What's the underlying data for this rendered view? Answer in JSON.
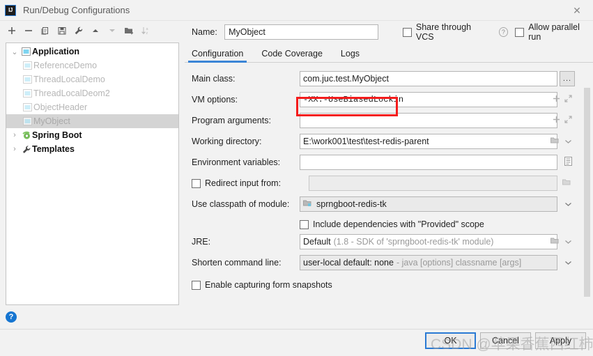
{
  "window": {
    "title": "Run/Debug Configurations",
    "app_icon": "intellij-idea-logo-icon",
    "close_icon": "✕"
  },
  "toolbar": {
    "buttons": [
      {
        "name": "add-configuration-button",
        "icon": "plus-icon"
      },
      {
        "name": "remove-configuration-button",
        "icon": "minus-icon"
      },
      {
        "name": "copy-configuration-button",
        "icon": "copy-icon"
      },
      {
        "name": "save-configuration-button",
        "icon": "save-icon"
      },
      {
        "name": "edit-templates-button",
        "icon": "wrench-icon"
      },
      {
        "name": "move-up-button",
        "icon": "arrow-up-icon"
      },
      {
        "name": "move-down-button",
        "icon": "arrow-down-icon"
      },
      {
        "name": "new-folder-button",
        "icon": "new-folder-icon"
      },
      {
        "name": "sort-configurations-button",
        "icon": "sort-az-icon"
      }
    ]
  },
  "tree": {
    "nodes": [
      {
        "label": "Application",
        "level": 0,
        "expanded": true,
        "twisty": "⌄",
        "icon": "application-icon",
        "selected": false
      },
      {
        "label": "ReferenceDemo",
        "level": 1,
        "twisty": "",
        "icon": "run-config-icon",
        "selected": false
      },
      {
        "label": "ThreadLocalDemo",
        "level": 1,
        "twisty": "",
        "icon": "run-config-icon",
        "selected": false
      },
      {
        "label": "ThreadLocalDeom2",
        "level": 1,
        "twisty": "",
        "icon": "run-config-icon",
        "selected": false
      },
      {
        "label": "ObjectHeader",
        "level": 1,
        "twisty": "",
        "icon": "run-config-icon",
        "selected": false
      },
      {
        "label": "MyObject",
        "level": 1,
        "twisty": "",
        "icon": "run-config-icon",
        "selected": true
      },
      {
        "label": "Spring Boot",
        "level": 0,
        "expanded": false,
        "twisty": "›",
        "icon": "spring-boot-icon",
        "selected": false
      },
      {
        "label": "Templates",
        "level": 0,
        "expanded": false,
        "twisty": "›",
        "icon": "wrench-icon",
        "selected": false
      }
    ]
  },
  "help": {
    "label": "?",
    "name": "help-button"
  },
  "header": {
    "name_label": "Name:",
    "name_value": "MyObject",
    "name_placeholder": "",
    "share_vcs_label": "Share through VCS",
    "share_vcs_checked": false,
    "share_help_icon": "question-mark-icon",
    "allow_parallel_label": "Allow parallel run",
    "allow_parallel_checked": false
  },
  "tabs": [
    {
      "label": "Configuration",
      "active": true
    },
    {
      "label": "Code Coverage",
      "active": false
    },
    {
      "label": "Logs",
      "active": false
    }
  ],
  "form": {
    "main_class": {
      "label": "Main class:",
      "value": "com.juc.test.MyObject",
      "browse_label": "..."
    },
    "vm_options": {
      "label": "VM options:",
      "value": "-XX:-UseBiasedLockin",
      "add_icon": "plus-icon",
      "expand_icon": "expand-icon",
      "highlighted": true,
      "highlight_color": "#f41c1c"
    },
    "program_arguments": {
      "label": "Program arguments:",
      "value": "",
      "add_icon": "plus-icon",
      "expand_icon": "expand-icon"
    },
    "working_directory": {
      "label": "Working directory:",
      "value": "E:\\work001\\test\\test-redis-parent",
      "folder_icon": "folder-icon",
      "chevron_icon": "chevron-down-icon"
    },
    "environment_variables": {
      "label": "Environment variables:",
      "value": "",
      "edit_icon": "document-list-icon"
    },
    "redirect_input": {
      "label": "Redirect input from:",
      "checked": false,
      "value": "",
      "folder_icon": "folder-icon"
    },
    "classpath_module": {
      "label": "Use classpath of module:",
      "value": "sprngboot-redis-tk",
      "module_icon": "module-icon",
      "chevron_icon": "chevron-down-icon"
    },
    "include_provided": {
      "label": "Include dependencies with \"Provided\" scope",
      "checked": false
    },
    "jre": {
      "label": "JRE:",
      "value": "Default",
      "value_hint": "(1.8 - SDK of 'sprngboot-redis-tk' module)",
      "folder_icon": "folder-icon",
      "chevron_icon": "chevron-down-icon"
    },
    "shorten_command_line": {
      "label": "Shorten command line:",
      "value": "user-local default: none",
      "value_hint": "- java [options] classname [args]",
      "chevron_icon": "chevron-down-icon"
    },
    "enable_snapshots": {
      "label": "Enable capturing form snapshots",
      "checked": false
    }
  },
  "footer": {
    "ok_label": "OK",
    "cancel_label": "Cancel",
    "apply_label": "Apply"
  },
  "watermark": {
    "text": "CSDN @苹果香蕉西红柿"
  },
  "colors": {
    "accent": "#3b85d6",
    "highlight": "#f41c1c",
    "help_blue": "#1675d1"
  }
}
